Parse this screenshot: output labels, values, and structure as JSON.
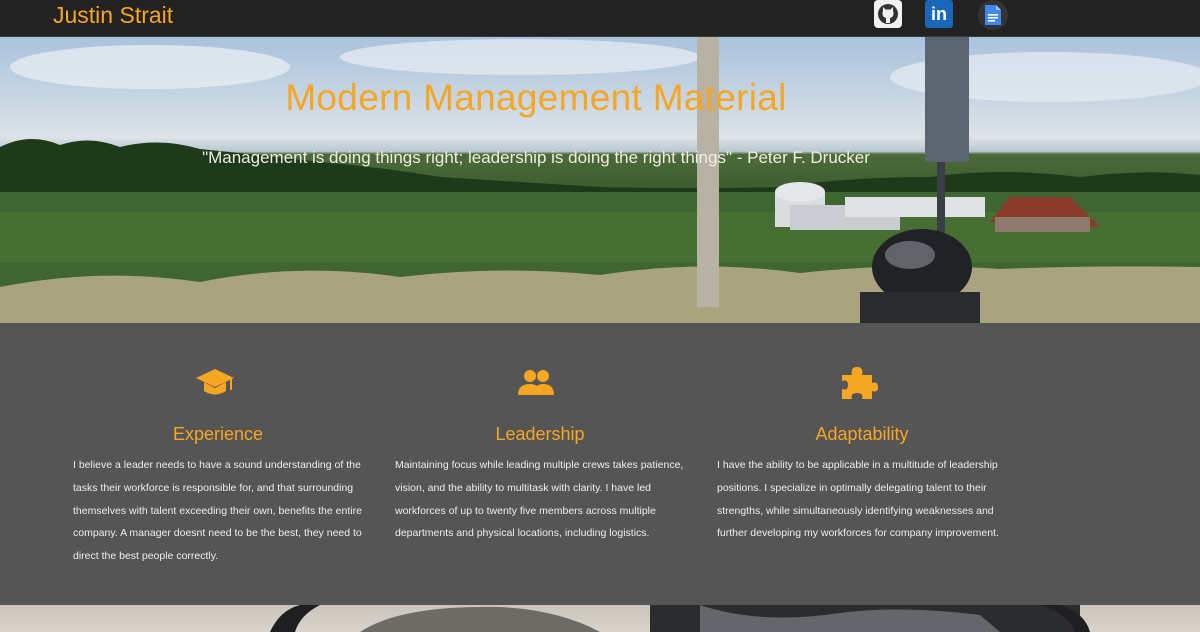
{
  "nav": {
    "brand": "Justin Strait",
    "icons": [
      {
        "name": "github-icon",
        "label": "GitHub"
      },
      {
        "name": "linkedin-icon",
        "label": "in"
      },
      {
        "name": "google-docs-icon",
        "label": "Docs"
      }
    ]
  },
  "hero": {
    "title": "Modern Management Material",
    "quote": "\"Management is doing things right; leadership is doing the right things\" - Peter F. Drucker"
  },
  "features": [
    {
      "icon": "graduation-cap-icon",
      "title": "Experience",
      "text": "I believe a leader needs to have a sound understanding of the tasks their workforce is responsible for, and that surrounding themselves with talent exceeding their own, benefits the entire company. A manager doesnt need to be the best, they need to direct the best people correctly."
    },
    {
      "icon": "users-icon",
      "title": "Leadership",
      "text": "Maintaining focus while leading multiple crews takes patience, vision, and the ability to multitask with clarity. I have led workforces of up to twenty five members across multiple departments and physical locations, including logistics."
    },
    {
      "icon": "puzzle-piece-icon",
      "title": "Adaptability",
      "text": "I have the ability to be applicable in a multitude of leadership positions. I specialize in optimally delegating talent to their strengths, while simultaneously identifying weaknesses and further developing my workforces for company improvement."
    }
  ],
  "colors": {
    "accent": "#f5a623",
    "navbar": "#222222",
    "features_bg": "#555555",
    "text_light": "#eeeeee"
  }
}
